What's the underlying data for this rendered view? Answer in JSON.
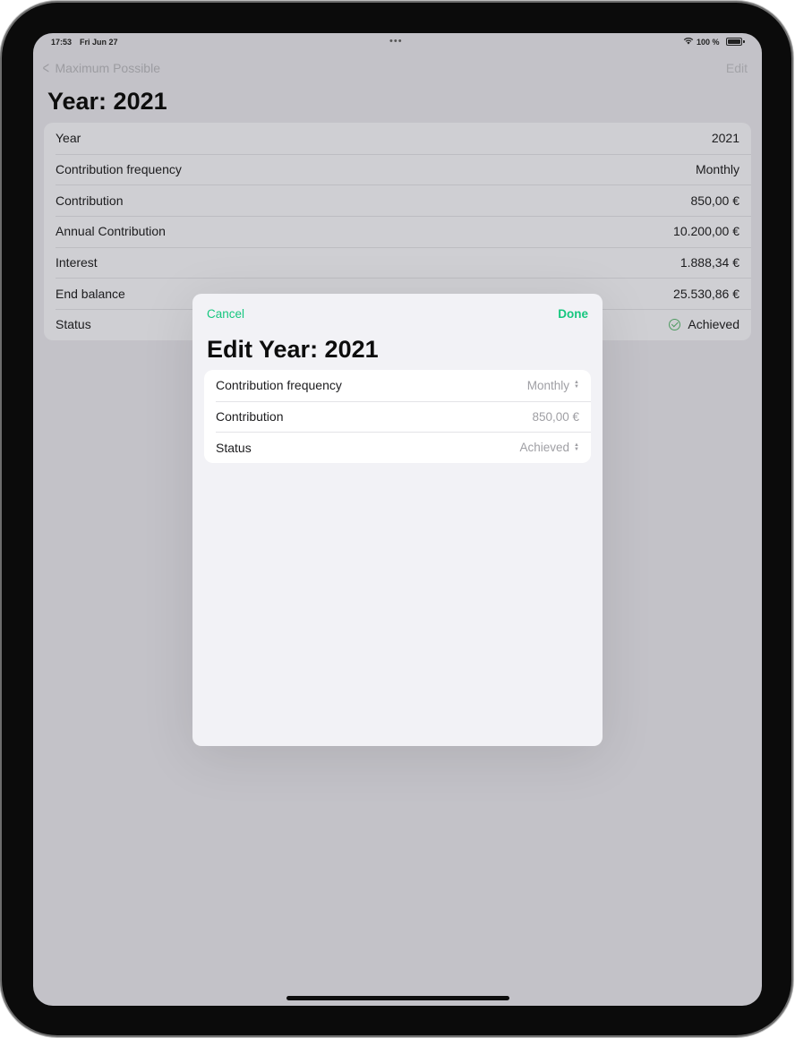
{
  "status_bar": {
    "time": "17:53",
    "date": "Fri Jun 27",
    "battery": "100 %"
  },
  "nav": {
    "back_label": "Maximum Possible",
    "edit_label": "Edit"
  },
  "page": {
    "title": "Year: 2021"
  },
  "details": [
    {
      "label": "Year",
      "value": "2021"
    },
    {
      "label": "Contribution frequency",
      "value": "Monthly"
    },
    {
      "label": "Contribution",
      "value": "850,00 €"
    },
    {
      "label": "Annual Contribution",
      "value": "10.200,00 €"
    },
    {
      "label": "Interest",
      "value": "1.888,34 €"
    },
    {
      "label": "End balance",
      "value": "25.530,86 €"
    },
    {
      "label": "Status",
      "value": "Achieved",
      "icon": "checkmark-circle-icon"
    }
  ],
  "sheet": {
    "cancel_label": "Cancel",
    "done_label": "Done",
    "title": "Edit Year: 2021",
    "fields": [
      {
        "label": "Contribution frequency",
        "value": "Monthly",
        "icon": "up-down-chevron-icon"
      },
      {
        "label": "Contribution",
        "value": "850,00 €"
      },
      {
        "label": "Status",
        "value": "Achieved",
        "icon": "up-down-chevron-icon"
      }
    ]
  },
  "colors": {
    "accent": "#16c77f",
    "status_green": "#4f9a62"
  }
}
